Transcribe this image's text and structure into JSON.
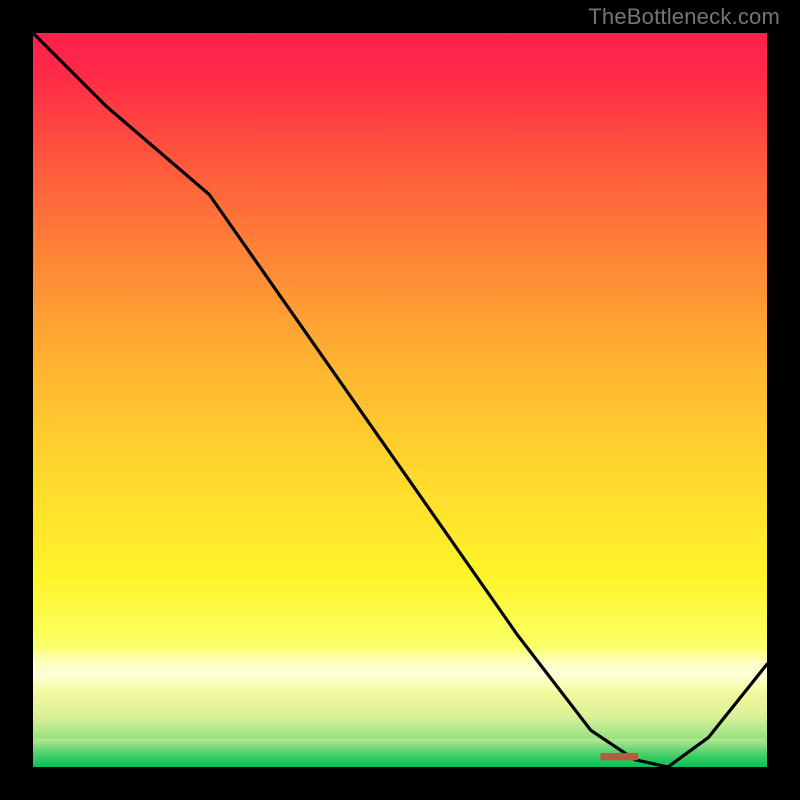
{
  "watermark": "TheBottleneck.com",
  "marker_text": "■■■■■■",
  "chart_data": {
    "type": "line",
    "title": "",
    "xlabel": "",
    "ylabel": "",
    "xlim": [
      0,
      100
    ],
    "ylim": [
      0,
      100
    ],
    "series": [
      {
        "name": "curve",
        "x": [
          0,
          10,
          24,
          38,
          52,
          66,
          76,
          82,
          86.5,
          92,
          100
        ],
        "y": [
          100,
          90,
          78,
          58,
          38,
          18,
          5,
          1,
          0,
          4,
          14
        ]
      }
    ],
    "marker": {
      "x": 84,
      "y": 1
    },
    "background_gradient": {
      "top": "#ff1f4b",
      "mid": "#ffd82d",
      "cream": "#fbffd6",
      "bottom": "#06c255"
    }
  }
}
